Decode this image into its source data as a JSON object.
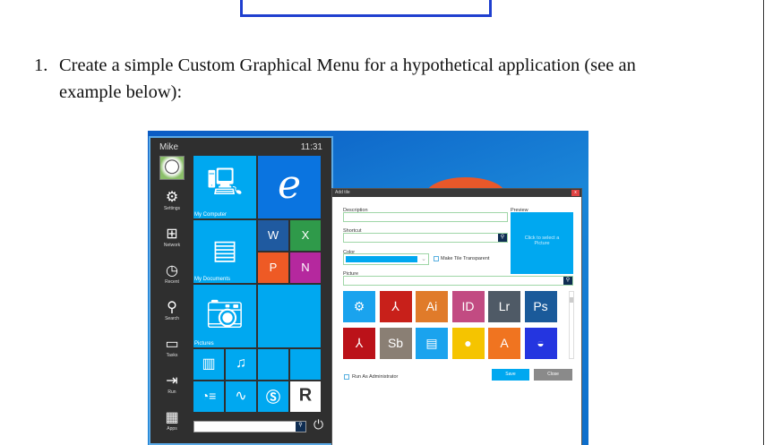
{
  "document": {
    "item_number": "1.",
    "text_line1": "Create a simple Custom Graphical Menu for a hypothetical application (see an",
    "text_line2": "example below):"
  },
  "start_menu": {
    "user": "Mike",
    "time": "11:31",
    "side_items": [
      {
        "label": "Settings",
        "icon": "gear-icon"
      },
      {
        "label": "Network",
        "icon": "network-icon"
      },
      {
        "label": "Recent",
        "icon": "recent-icon"
      },
      {
        "label": "Search",
        "icon": "search-icon"
      },
      {
        "label": "Tasks",
        "icon": "tasks-icon"
      },
      {
        "label": "Run",
        "icon": "run-icon"
      },
      {
        "label": "Apps",
        "icon": "apps-icon"
      }
    ],
    "tiles": {
      "my_computer": "My Computer",
      "my_documents": "My Documents",
      "pictures": "Pictures",
      "word": "W",
      "excel": "X",
      "powerpoint": "P",
      "onenote": "N"
    },
    "search_placeholder": ""
  },
  "dialog": {
    "title": "Add tile",
    "close_glyph": "x",
    "description_label": "Description",
    "shortcut_label": "Shortcut",
    "color_label": "Color",
    "transparent_label": "Make Tile Transparent",
    "picture_label": "Picture",
    "preview_label": "Preview",
    "preview_text": "Click to select a Picture",
    "icons": [
      {
        "text": "⚙",
        "color": "#1aa3ee"
      },
      {
        "text": "⅄",
        "color": "#c8201a"
      },
      {
        "text": "Ai",
        "color": "#e07b2a"
      },
      {
        "text": "ID",
        "color": "#c24b82"
      },
      {
        "text": "Lr",
        "color": "#4f5a66"
      },
      {
        "text": "Ps",
        "color": "#1a5a9a"
      },
      {
        "text": "⅄",
        "color": "#bb1219"
      },
      {
        "text": "Sb",
        "color": "#8a7f74"
      },
      {
        "text": "▤",
        "color": "#1aa3ee"
      },
      {
        "text": "●",
        "color": "#f5c400"
      },
      {
        "text": "A",
        "color": "#f07420"
      },
      {
        "text": "◒",
        "color": "#2435e0"
      }
    ],
    "run_admin_label": "Run As Administrator",
    "save_label": "Save",
    "close_label": "Close",
    "color_value": "#00a8f0"
  }
}
